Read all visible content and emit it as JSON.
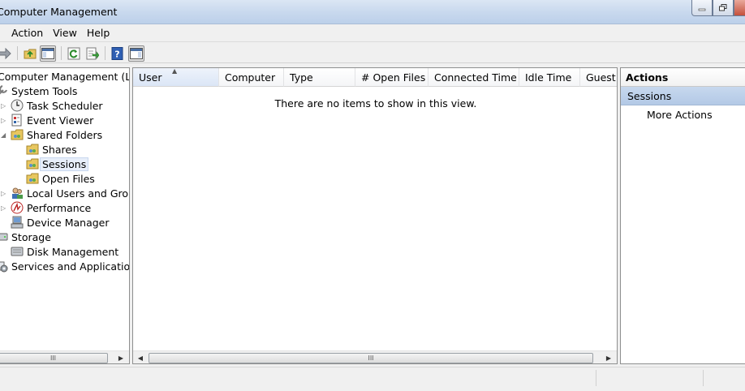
{
  "window": {
    "title": "Computer Management"
  },
  "menu": [
    "Action",
    "View",
    "Help"
  ],
  "tree": {
    "root": "Computer Management (Local)",
    "system_tools": "System Tools",
    "task_scheduler": "Task Scheduler",
    "event_viewer": "Event Viewer",
    "shared_folders": "Shared Folders",
    "shares": "Shares",
    "sessions": "Sessions",
    "open_files": "Open Files",
    "local_users": "Local Users and Groups",
    "performance": "Performance",
    "device_manager": "Device Manager",
    "storage": "Storage",
    "disk_management": "Disk Management",
    "services": "Services and Applications"
  },
  "list": {
    "columns": [
      "User",
      "Computer",
      "Type",
      "# Open Files",
      "Connected Time",
      "Idle Time",
      "Guest"
    ],
    "sorted_column": "User",
    "empty_message": "There are no items to show in this view."
  },
  "actions": {
    "header": "Actions",
    "section": "Sessions",
    "items": [
      "More Actions"
    ]
  },
  "scrollbar_grip": "III",
  "colors": {
    "selection": "#e7eefa",
    "section_bg": "#b3c9e6",
    "title_bg": "#c9d9ee"
  }
}
